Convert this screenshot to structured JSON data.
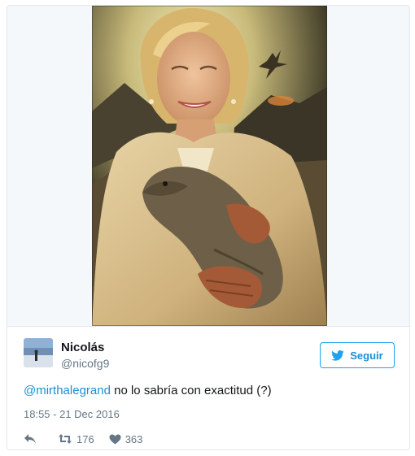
{
  "tweet": {
    "author": {
      "name": "Nicolás",
      "handle": "@nicofg9"
    },
    "follow_label": "Seguir",
    "mention": "@mirthalegrand",
    "text": " no lo sabría con exactitud (?)",
    "timestamp": "18:55 - 21 Dec 2016",
    "retweets": "176",
    "likes": "363"
  },
  "colors": {
    "accent": "#1da1f2",
    "link": "#1b8fd4",
    "muted": "#657786",
    "border": "#e1e8ed"
  },
  "icons": {
    "reply": "reply-icon",
    "retweet": "retweet-icon",
    "like": "heart-icon",
    "follow": "twitter-bird-icon"
  }
}
